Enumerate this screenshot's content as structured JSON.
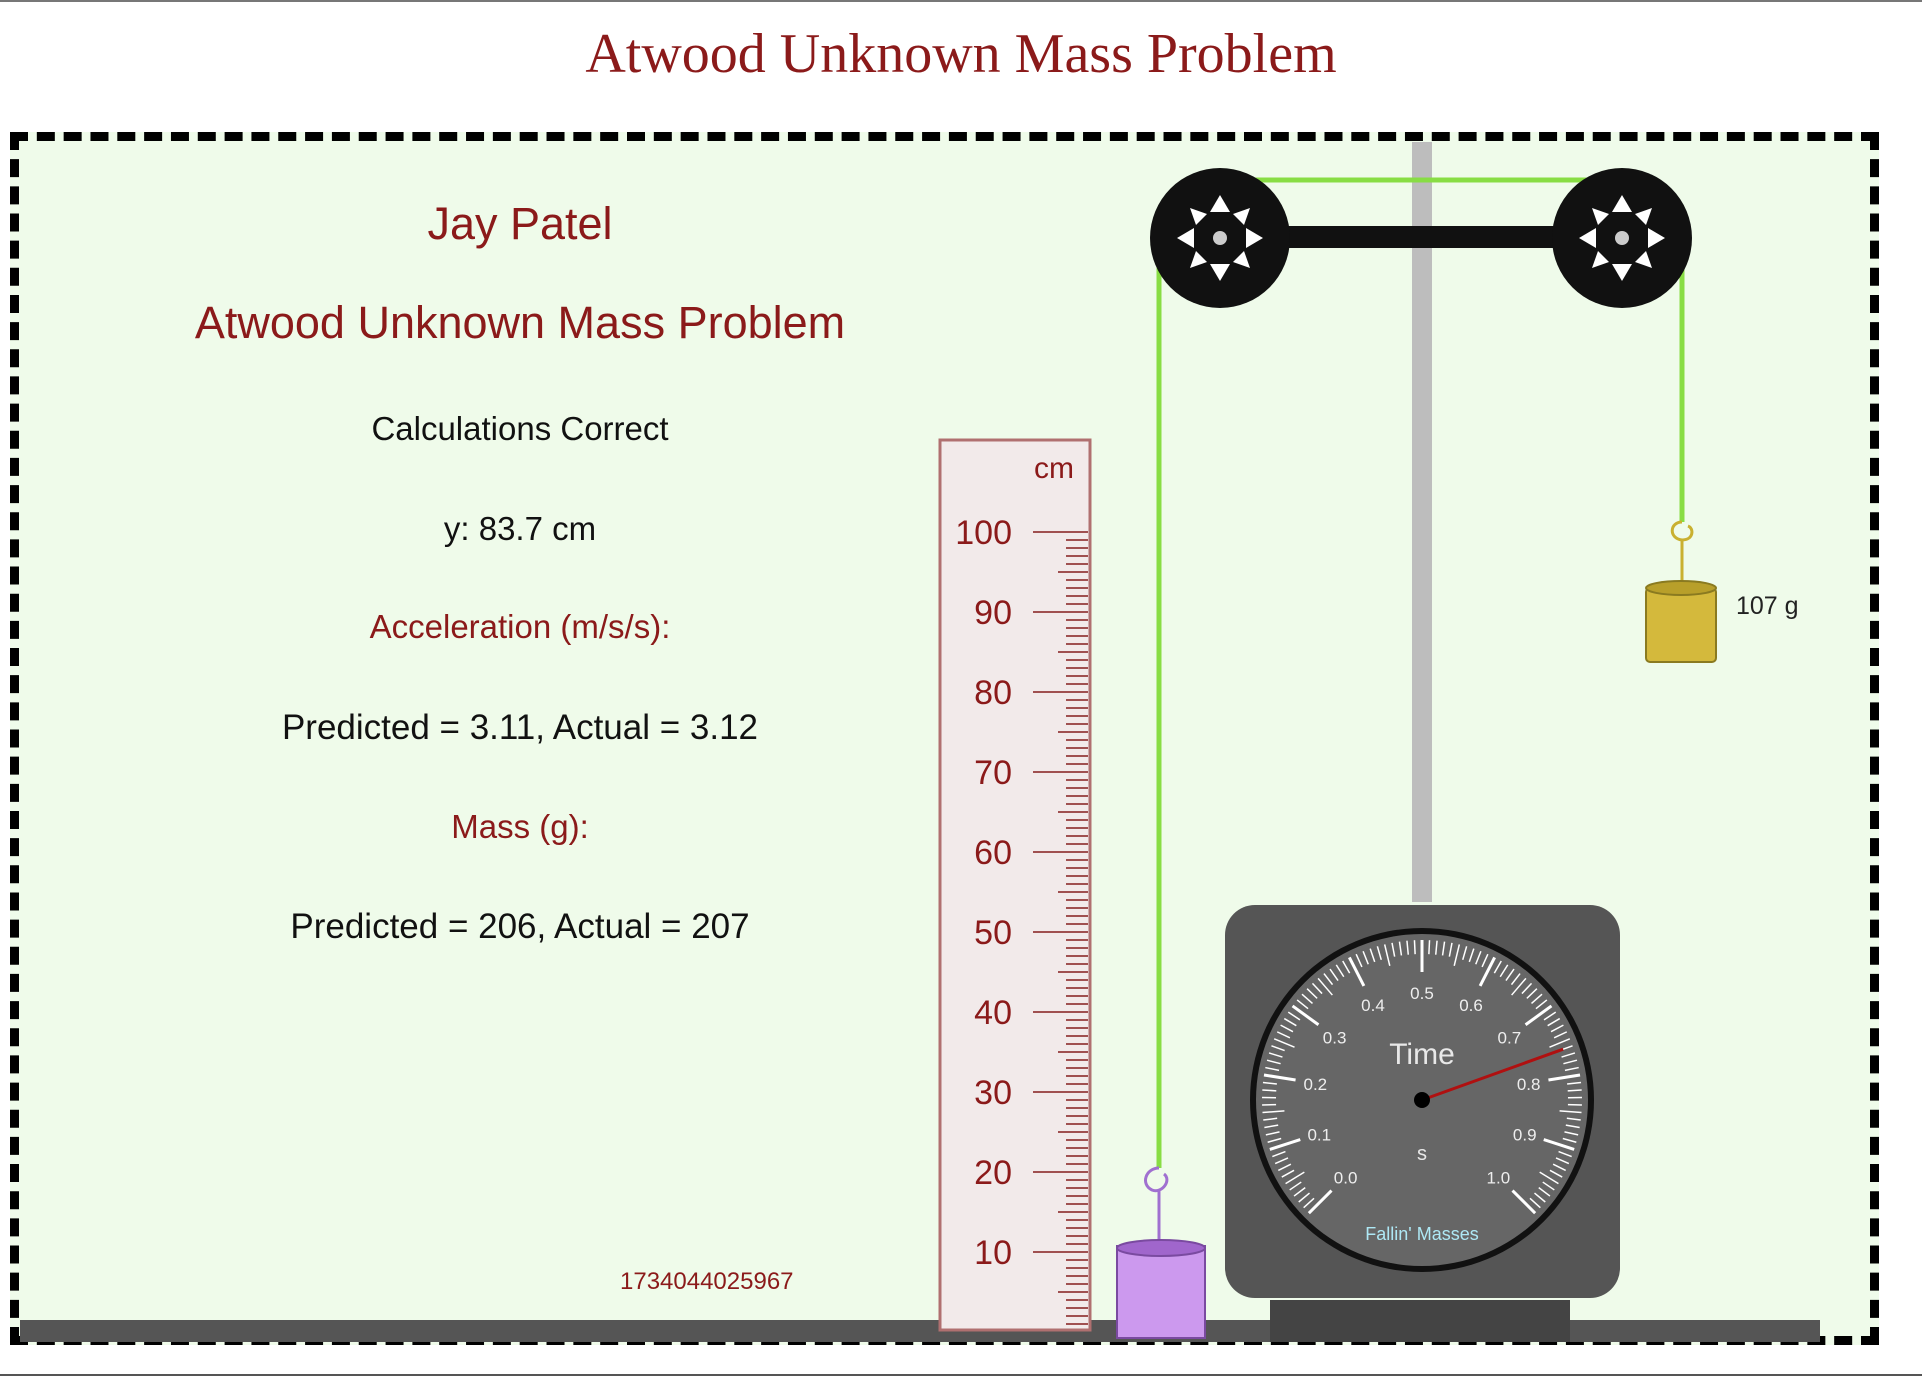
{
  "page_title": "Atwood Unknown Mass Problem",
  "panel": {
    "student_name": "Jay Patel",
    "problem_title": "Atwood Unknown Mass Problem",
    "status": "Calculations Correct",
    "y_value": "y: 83.7 cm",
    "acceleration_heading": "Acceleration (m/s/s):",
    "acceleration_values": "Predicted = 3.11, Actual = 3.12",
    "mass_heading": "Mass (g):",
    "mass_values": "Predicted = 206, Actual = 207",
    "id_stamp": "1734044025967"
  },
  "ruler": {
    "unit": "cm",
    "labels": [
      "100",
      "90",
      "80",
      "70",
      "60",
      "50",
      "40",
      "30",
      "20",
      "10"
    ]
  },
  "hanging_mass_label": "107 g",
  "timer": {
    "title": "Time",
    "unit": "s",
    "brand": "Fallin' Masses",
    "dial_labels": [
      "0.0",
      "0.1",
      "0.2",
      "0.3",
      "0.4",
      "0.5",
      "0.6",
      "0.7",
      "0.8",
      "0.9",
      "1.0"
    ],
    "reading_s": 0.76
  },
  "colors": {
    "title_red": "#8b1a1a",
    "string_green": "#88dd44",
    "right_mass_gold": "#d4b93c",
    "left_mass_purple": "#cc99ee",
    "panel_bg": "#effbea"
  }
}
